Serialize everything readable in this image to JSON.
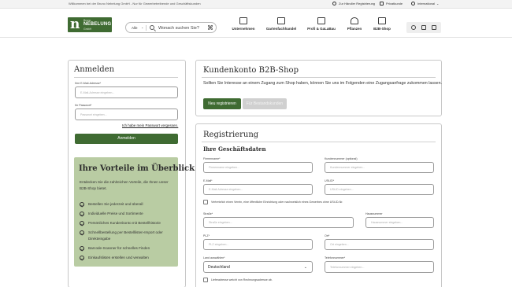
{
  "topbar": {
    "welcome": "Willkommen bei der Bruno Nebelung GmbH - Nur für Gewerbetreibende und Geschäftskunden",
    "links": [
      "Zur Händler Registrierung",
      "Privatkunde",
      "International"
    ]
  },
  "header": {
    "logo": {
      "letter": "n",
      "top": "Bruno",
      "name": "NEBELUNG",
      "bottom": "GmbH"
    },
    "search": {
      "select": "Alle",
      "placeholder": "Wonach suchen Sie?"
    },
    "nav": [
      "Unternehmen",
      "Gartenfachhandel",
      "Profi & GaLaBau",
      "Pflanzen",
      "B2B-Shop"
    ]
  },
  "login": {
    "title": "Anmelden",
    "email_label": "Ihre E-Mail-Adresse*",
    "email_placeholder": "E-Mail-Adresse eingeben...",
    "password_label": "Ihr Passwort*",
    "password_placeholder": "Passwort eingeben...",
    "forgot": "Ich habe mein Passwort vergessen.",
    "submit": "Anmelden"
  },
  "benefits": {
    "title": "Ihre Vorteile im Überblick",
    "description": "Entdecken Sie die zahlreichen Vorteile, die Ihnen unser B2B-Shop bietet.",
    "items": [
      "Bestellen Sie jederzeit und überall",
      "Individuelle Preise und Sortimente",
      "Persönliches Kundenkonto mit Bestellhistorie",
      "Schnellbestellung per Bestelllisten-Import oder Direkteingabe",
      "Barcode-Scanner für schnelles Finden",
      "Einkaufslisten erstellen und verwalten"
    ]
  },
  "account": {
    "title": "Kundenkonto B2B-Shop",
    "intro": "Sollten Sie Interesse an einem Zugang zum Shop haben, können Sie uns im Folgenden eine Zugangsanfrage zukommen lassen.",
    "tab_new": "Neu registrieren",
    "tab_existing": "Für Bestandskunden"
  },
  "register": {
    "title": "Registrierung",
    "subtitle": "Ihre Geschäftsdaten",
    "company_label": "Firmenname*",
    "company_placeholder": "Firmenname eingeben...",
    "customer_no_label": "Kundennummer (optional)",
    "customer_no_placeholder": "Kundennummer eingeben...",
    "email_label": "E-Mail*",
    "email_placeholder": "E-Mail-Adresse eingeben...",
    "ustid_label": "USt-ID*",
    "ustid_placeholder": "USt-ID eingeben...",
    "checkbox_public": "Vertrete/ich einen Verein, eine öffentliche Einrichtung oder nachweislich eines Gewerbes ohne USt-ID-Nr.",
    "street_label": "Straße*",
    "street_placeholder": "Straße eingeben...",
    "house_label": "Hausnummer",
    "house_placeholder": "Hausnummer eingeben...",
    "zip_label": "PLZ*",
    "zip_placeholder": "PLZ eingeben...",
    "city_label": "Ort*",
    "city_placeholder": "Ort eingeben...",
    "country_label": "Land auswählen*",
    "country_value": "Deutschland",
    "phone_label": "Telefonnummer*",
    "phone_placeholder": "Telefonnummer eingeben...",
    "checkbox_delivery": "Lieferadresse weicht von Rechnungsadresse ab."
  },
  "colors": {
    "brand_green": "#3f6b32",
    "benefits_bg": "#b9cca3"
  }
}
